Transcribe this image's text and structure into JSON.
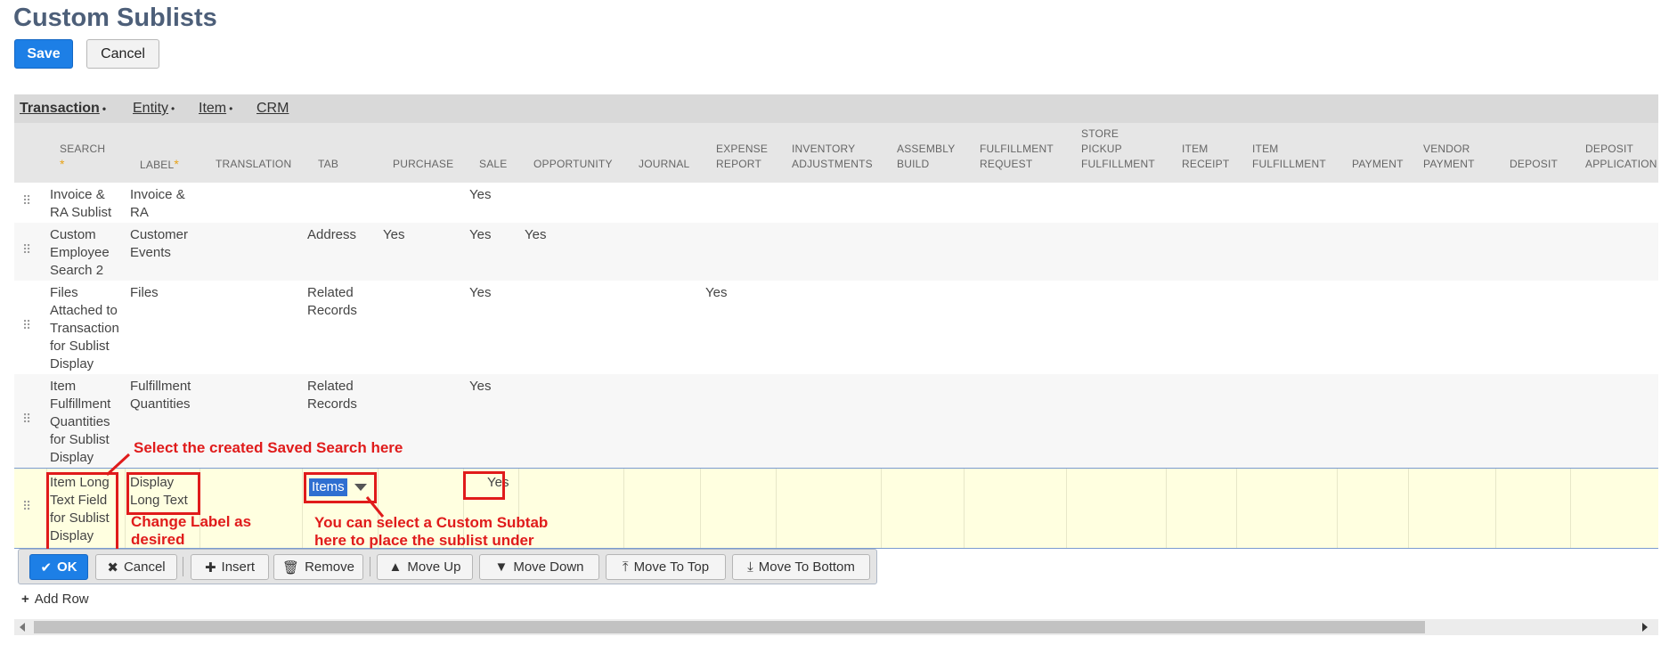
{
  "page": {
    "title": "Custom Sublists"
  },
  "buttons": {
    "save": "Save",
    "cancel": "Cancel"
  },
  "tabs": [
    {
      "label": "Transaction",
      "dot": "•"
    },
    {
      "label": "Entity",
      "dot": "•"
    },
    {
      "label": "Item",
      "dot": "•"
    },
    {
      "label": "CRM",
      "dot": ""
    }
  ],
  "columns": {
    "search": "SEARCH",
    "label": "LABEL",
    "translation": "TRANSLATION",
    "tab": "TAB",
    "purchase": "PURCHASE",
    "sale": "SALE",
    "opportunity": "OPPORTUNITY",
    "journal": "JOURNAL",
    "expense_report": [
      "EXPENSE",
      "REPORT"
    ],
    "inventory_adjustments": [
      "INVENTORY",
      "ADJUSTMENTS"
    ],
    "assembly_build": [
      "ASSEMBLY",
      "BUILD"
    ],
    "fulfillment_request": [
      "FULFILLMENT",
      "REQUEST"
    ],
    "store_pickup_fulfillment": [
      "STORE",
      "PICKUP",
      "FULFILLMENT"
    ],
    "item_receipt": [
      "ITEM",
      "RECEIPT"
    ],
    "item_fulfillment": [
      "ITEM",
      "FULFILLMENT"
    ],
    "payment": "PAYMENT",
    "vendor_payment": [
      "VENDOR",
      "PAYMENT"
    ],
    "deposit": "DEPOSIT",
    "deposit_application": [
      "DEPOSIT",
      "APPLICATION"
    ],
    "required_mark": "*"
  },
  "rows": [
    {
      "search": [
        "Invoice &",
        "RA Sublist"
      ],
      "label": [
        "Invoice &",
        "RA"
      ],
      "tab": [],
      "purchase": "",
      "sale": "Yes",
      "opportunity": "",
      "expense_report": ""
    },
    {
      "search": [
        "Custom",
        "Employee",
        "Search 2"
      ],
      "label": [
        "Customer",
        "Events"
      ],
      "tab": [
        "Address"
      ],
      "purchase": "Yes",
      "sale": "Yes",
      "opportunity": "Yes",
      "expense_report": ""
    },
    {
      "search": [
        "Files",
        "Attached to",
        "Transaction",
        "for Sublist",
        "Display"
      ],
      "label": [
        "Files"
      ],
      "tab": [
        "Related",
        "Records"
      ],
      "purchase": "",
      "sale": "Yes",
      "opportunity": "",
      "expense_report": "Yes"
    },
    {
      "search": [
        "Item",
        "Fulfillment",
        "Quantities",
        "for Sublist",
        "Display"
      ],
      "label": [
        "Fulfillment",
        "Quantities"
      ],
      "tab": [
        "Related",
        "Records"
      ],
      "purchase": "",
      "sale": "Yes",
      "opportunity": "",
      "expense_report": ""
    }
  ],
  "edit_row": {
    "search": [
      "Item Long",
      "Text Field",
      "for Sublist",
      "Display"
    ],
    "label": [
      "Display",
      "Long Text"
    ],
    "tab_value": "Items",
    "sale": "Yes"
  },
  "annotations": {
    "saved_search": "Select the created Saved Search here",
    "change_label": [
      "Change Label as",
      "desired"
    ],
    "custom_subtab": [
      "You can select a Custom Subtab",
      "here to place the sublist under"
    ]
  },
  "toolbar": {
    "ok": "OK",
    "cancel": "Cancel",
    "insert": "Insert",
    "remove": "Remove",
    "move_up": "Move Up",
    "move_down": "Move Down",
    "move_to_top": "Move To Top",
    "move_to_bottom": "Move To Bottom"
  },
  "add_row": {
    "label": "Add Row"
  },
  "icons": {
    "drag_handle": "drag-handle-icon",
    "check": "check-icon",
    "x": "x-icon",
    "plus": "plus-icon",
    "trash": "trash-icon",
    "up": "arrow-up-icon",
    "down": "arrow-down-icon",
    "top": "arrow-top-icon",
    "bottom": "arrow-bottom-icon"
  },
  "colors": {
    "title": "#4d5f79",
    "primary_button": "#1d7fe6",
    "annotation_red": "#e01b1b",
    "edit_row_bg": "#ffffe0",
    "required_star": "#e8a317"
  }
}
